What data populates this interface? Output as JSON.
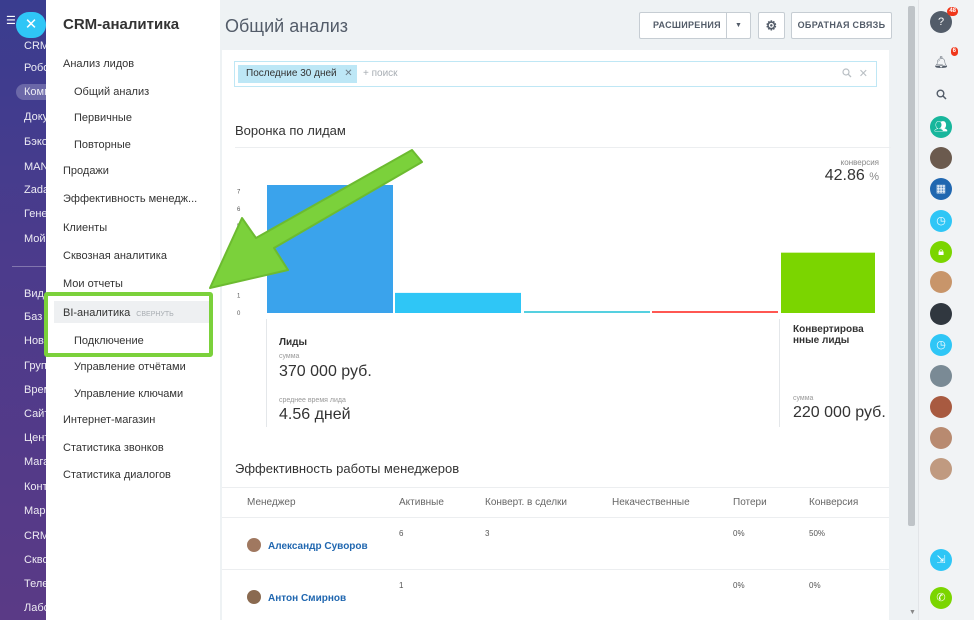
{
  "leftnav": {
    "items": [
      "CRM",
      "Робо",
      "Комп",
      "Доку",
      "Бэко",
      "MAN",
      "Zada",
      "Гене",
      "Мой",
      "Вид",
      "Баз",
      "Нов",
      "Груп",
      "Врем",
      "Сайт",
      "Цент",
      "Мага",
      "Конт",
      "Мар",
      "CRM",
      "Скво",
      "Теле",
      "Лабо"
    ]
  },
  "submenu": {
    "title": "CRM-аналитика",
    "items": [
      "Анализ лидов",
      "Общий анализ",
      "Первичные",
      "Повторные",
      "Продажи",
      "Эффективность менедж...",
      "Клиенты",
      "Сквозная аналитика",
      "Мои отчеты",
      "BI-аналитика",
      "Подключение",
      "Управление отчётами",
      "Управление ключами",
      "Интернет-магазин",
      "Статистика звонков",
      "Статистика диалогов"
    ],
    "bi_collapse": "свернуть"
  },
  "header": {
    "title": "Общий анализ",
    "extensions_label": "РАСШИРЕНИЯ",
    "feedback_label": "ОБРАТНАЯ СВЯЗЬ"
  },
  "filter": {
    "chip": "Последние 30 дней",
    "placeholder": "+ поиск"
  },
  "funnel": {
    "title": "Воронка по лидам",
    "conversion_label": "конверсия",
    "conversion_value": "42.86",
    "conversion_unit": "%",
    "leads_label": "Лиды",
    "sum_label": "сумма",
    "sum_value": "370 000 руб.",
    "avg_time_label": "среднее время лида",
    "avg_time_value": "4.56 дней",
    "converted_label_1": "Конвертирова",
    "converted_label_2": "нные лиды",
    "converted_sum_label": "сумма",
    "converted_sum_value": "220 000 руб."
  },
  "chart_data": {
    "type": "bar",
    "yticks": [
      0,
      1,
      2,
      3,
      4,
      5,
      6,
      7
    ],
    "ylim": [
      0,
      7
    ],
    "values": [
      7,
      1.1,
      0.1,
      0.1,
      3.3
    ],
    "colors": [
      "#3aa3ec",
      "#2fc6f6",
      "#55d0e0",
      "#ff5752",
      "#7bd500"
    ]
  },
  "managers": {
    "title": "Эффективность работы менеджеров",
    "columns": [
      "Менеджер",
      "Активные",
      "Конверт. в сделки",
      "Некачественные",
      "Потери",
      "Конверсия"
    ],
    "rows": [
      {
        "name": "Александр Суворов",
        "active": "6",
        "converted": "3",
        "bad": "",
        "lost": "0%",
        "conversion": "50%"
      },
      {
        "name": "Антон Смирнов",
        "active": "1",
        "converted": "",
        "bad": "",
        "lost": "0%",
        "conversion": "0%"
      }
    ]
  },
  "rightbar": {
    "help_badge": "48",
    "notif_badge": "6"
  }
}
